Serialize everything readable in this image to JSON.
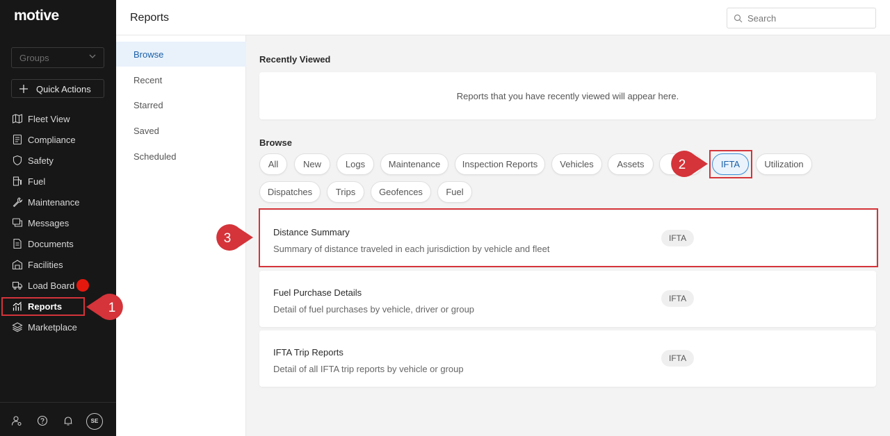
{
  "app": {
    "logo": "motive",
    "page_title": "Reports",
    "search_placeholder": "Search"
  },
  "sidebar": {
    "groups_placeholder": "Groups",
    "quick_actions": "Quick Actions",
    "items": [
      {
        "label": "Fleet View",
        "icon": "map-icon"
      },
      {
        "label": "Compliance",
        "icon": "document-list-icon"
      },
      {
        "label": "Safety",
        "icon": "shield-icon"
      },
      {
        "label": "Fuel",
        "icon": "fuel-pump-icon"
      },
      {
        "label": "Maintenance",
        "icon": "wrench-icon"
      },
      {
        "label": "Messages",
        "icon": "chat-icon"
      },
      {
        "label": "Documents",
        "icon": "document-icon"
      },
      {
        "label": "Facilities",
        "icon": "building-icon"
      },
      {
        "label": "Load Board",
        "icon": "truck-icon"
      },
      {
        "label": "Reports",
        "icon": "chart-icon"
      },
      {
        "label": "Marketplace",
        "icon": "layers-icon"
      }
    ],
    "avatar_initials": "SE"
  },
  "subnav": {
    "items": [
      "Browse",
      "Recent",
      "Starred",
      "Saved",
      "Scheduled"
    ],
    "active": "Browse"
  },
  "recently_viewed": {
    "title": "Recently Viewed",
    "empty_text": "Reports that you have recently viewed will appear here."
  },
  "browse": {
    "title": "Browse",
    "filters_row1": [
      "All",
      "New",
      "Logs",
      "Maintenance",
      "Inspection Reports",
      "Vehicles",
      "Assets",
      "IFTA",
      "Utilization"
    ],
    "filters_row2": [
      "Dispatches",
      "Trips",
      "Geofences",
      "Fuel"
    ],
    "selected_filter": "IFTA"
  },
  "reports": [
    {
      "title": "Distance Summary",
      "description": "Summary of distance traveled in each jurisdiction by vehicle and fleet",
      "tag": "IFTA"
    },
    {
      "title": "Fuel Purchase Details",
      "description": "Detail of fuel purchases by vehicle, driver or group",
      "tag": "IFTA"
    },
    {
      "title": "IFTA Trip Reports",
      "description": "Detail of all IFTA trip reports by vehicle or group",
      "tag": "IFTA"
    }
  ],
  "annotations": {
    "step1": "1",
    "step2": "2",
    "step3": "3",
    "color": "#d4343a"
  },
  "colors": {
    "sidebar_bg": "#171717",
    "accent": "#1a5fa8",
    "badge": "#e5180e"
  }
}
